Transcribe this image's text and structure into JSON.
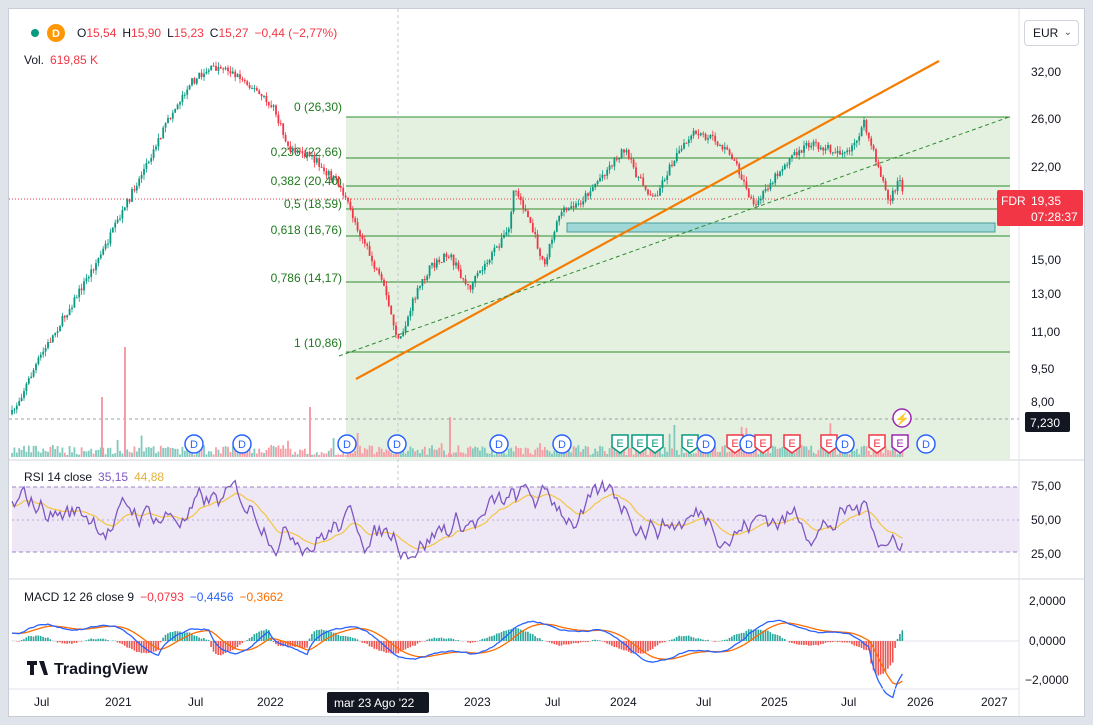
{
  "legend": {
    "interval": "D",
    "open_label": "O",
    "open": "15,54",
    "high_label": "H",
    "high": "15,90",
    "low_label": "L",
    "low": "15,23",
    "close_label": "C",
    "close": "15,27",
    "change": "−0,44 (−2,77%)",
    "vol_label": "Vol.",
    "vol": "619,85 K"
  },
  "currency": "EUR",
  "price_axis": [
    "32,00",
    "26,00",
    "22,00",
    "15,00",
    "13,00",
    "11,00",
    "9,50",
    "8,00"
  ],
  "price_tag": {
    "symbol": "FDR",
    "price": "19,35",
    "countdown": "07:28:37"
  },
  "crosshair_price": "7,230",
  "fib_levels": [
    {
      "label": "0 (26,30)"
    },
    {
      "label": "0,236 (22,66)"
    },
    {
      "label": "0,382 (20,40)"
    },
    {
      "label": "0,5 (18,59)"
    },
    {
      "label": "0,618 (16,76)"
    },
    {
      "label": "0,786 (14,17)"
    },
    {
      "label": "1 (10,86)"
    }
  ],
  "event_markers": {
    "dividend": "D",
    "earnings": "E",
    "flash": "⚡",
    "items": [
      "D",
      "D",
      "D",
      "D",
      "D",
      "D",
      "E",
      "E",
      "E",
      "E",
      "D",
      "E",
      "D",
      "E",
      "E",
      "E",
      "D",
      "E",
      "E",
      "D"
    ]
  },
  "rsi": {
    "title": "RSI 14 close",
    "value": "35,15",
    "ma": "44,88",
    "axis": [
      "75,00",
      "50,00",
      "25,00"
    ]
  },
  "macd": {
    "title": "MACD 12 26 close 9",
    "hist": "−0,0793",
    "macd": "−0,4456",
    "signal": "−0,3662",
    "axis": [
      "2,0000",
      "0,0000",
      "−2,0000"
    ]
  },
  "time_axis": [
    "Jul",
    "2021",
    "Jul",
    "2022",
    "2023",
    "Jul",
    "2024",
    "Jul",
    "2025",
    "Jul",
    "2026",
    "2027"
  ],
  "crosshair_date": "mar 23 Ago '22",
  "brand": "TradingView",
  "colors": {
    "up": "#089981",
    "down": "#f23645",
    "fib_line": "#2e8b2e",
    "fib_fill": "#e4f1e0",
    "trend": "#f57c00",
    "rsi_line": "#7e57c2",
    "rsi_ma": "#f5c542",
    "rsi_band": "#ede7f6",
    "macd_line": "#2962ff",
    "signal_line": "#ff6d00",
    "zone": "#9fd8d6"
  }
}
